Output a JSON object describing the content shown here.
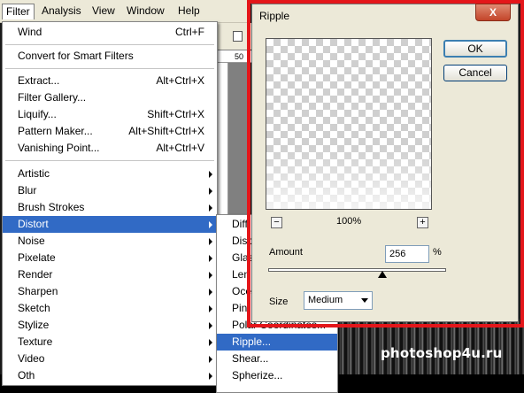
{
  "menubar": {
    "items": [
      "Filter",
      "Analysis",
      "View",
      "Window",
      "Help"
    ]
  },
  "filter_menu": {
    "items": [
      {
        "label": "Wind",
        "shortcut": "Ctrl+F"
      },
      {
        "label": "Convert for Smart Filters",
        "shortcut": ""
      },
      {
        "label": "Extract...",
        "shortcut": "Alt+Ctrl+X"
      },
      {
        "label": "Filter Gallery...",
        "shortcut": ""
      },
      {
        "label": "Liquify...",
        "shortcut": "Shift+Ctrl+X"
      },
      {
        "label": "Pattern Maker...",
        "shortcut": "Alt+Shift+Ctrl+X"
      },
      {
        "label": "Vanishing Point...",
        "shortcut": "Alt+Ctrl+V"
      },
      {
        "label": "Artistic"
      },
      {
        "label": "Blur"
      },
      {
        "label": "Brush Strokes"
      },
      {
        "label": "Distort"
      },
      {
        "label": "Noise"
      },
      {
        "label": "Pixelate"
      },
      {
        "label": "Render"
      },
      {
        "label": "Sharpen"
      },
      {
        "label": "Sketch"
      },
      {
        "label": "Stylize"
      },
      {
        "label": "Texture"
      },
      {
        "label": "Video"
      },
      {
        "label": "Oth"
      }
    ]
  },
  "distort_menu": {
    "items": [
      "Diff",
      "Disp",
      "Glas",
      "Len",
      "Oce",
      "Pin",
      "Polar Coordinates...",
      "Ripple...",
      "Shear...",
      "Spherize..."
    ]
  },
  "ruler": {
    "mark": "50"
  },
  "dialog": {
    "title": "Ripple",
    "close": "X",
    "ok": "OK",
    "cancel": "Cancel",
    "zoom": "100%",
    "zoom_minus": "−",
    "zoom_plus": "+",
    "amount_label": "Amount",
    "amount_value": "256",
    "amount_unit": "%",
    "amount_fraction": 0.64,
    "size_label": "Size",
    "size_value": "Medium"
  },
  "watermark": "photoshop4u.ru",
  "colors": {
    "highlight": "#316ac5",
    "outline": "#e4161a"
  }
}
